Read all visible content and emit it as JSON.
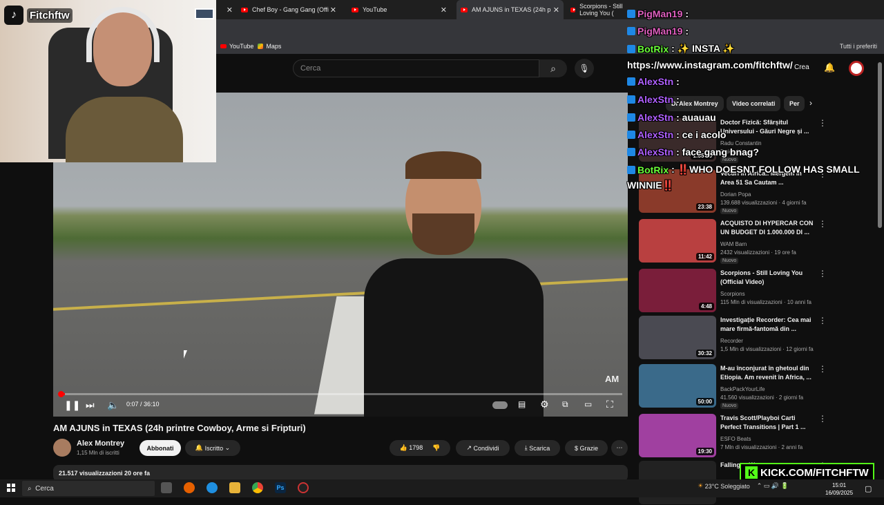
{
  "browser": {
    "tabs": [
      {
        "label": "Chef Boy - Gang Gang (Offi",
        "active": false
      },
      {
        "label": "YouTube",
        "active": false
      },
      {
        "label": "AM AJUNS in TEXAS (24h p",
        "active": true
      },
      {
        "label": "Scorpions - Still Loving You (",
        "active": false
      }
    ],
    "bookmarks": [
      "YouTube",
      "Maps"
    ],
    "all_bookmarks_label": "Tutti i preferiti"
  },
  "streamer": {
    "tiktok_name": "Fitchftw"
  },
  "header": {
    "search_placeholder": "Cerca",
    "create_label": "Crea"
  },
  "player": {
    "current_time": "0:07",
    "duration": "36:10",
    "time_display": "0:07 / 36:10",
    "progress_fraction": 0.0032,
    "watermark": "AM"
  },
  "video": {
    "title": "AM AJUNS in TEXAS (24h printre Cowboy, Arme si Fripturi)",
    "channel": "Alex Montrey",
    "subscribers": "1,15 Mln di iscritti",
    "subscribe_label": "Abbonati",
    "joined_label": "Iscritto",
    "likes": "1798",
    "share_label": "Condividi",
    "download_label": "Scarica",
    "thanks_label": "Grazie",
    "views_line": "21.517 visualizzazioni  20 ore fa"
  },
  "sidebar": {
    "chips": [
      "Di Alex Montrey",
      "Video correlati",
      "Per"
    ],
    "recs": [
      {
        "title": "Doctor Fizică: Sfârșitul Universului - Găuri Negre și ...",
        "channel": "Radu Constantin",
        "meta": "5 giorni fa",
        "badge": "Nuovo",
        "duration": "1:35:13",
        "thumb_color": "#3a2a2a"
      },
      {
        "title": "Vecuri în Africa.. Mergem în Area 51 Sa Cautam ...",
        "channel": "Dorian Popa",
        "meta": "139.688 visualizzazioni · 4 giorni fa",
        "badge": "Nuovo",
        "duration": "23:38",
        "thumb_color": "#8a3a2a"
      },
      {
        "title": "ACQUISTO DI HYPERCAR CON UN BUDGET DI 1.000.000 DI ...",
        "channel": "WAM Barn",
        "meta": "2432 visualizzazioni · 19 ore fa",
        "badge": "Nuovo",
        "duration": "11:42",
        "thumb_color": "#b94040"
      },
      {
        "title": "Scorpions - Still Loving You (Official Video)",
        "channel": "Scorpions",
        "meta": "115 Mln di visualizzazioni · 10 anni fa",
        "badge": "",
        "duration": "4:48",
        "thumb_color": "#7a1e3a"
      },
      {
        "title": "Investigație Recorder: Cea mai mare firmă-fantomă din ...",
        "channel": "Recorder",
        "meta": "1,5 Mln di visualizzazioni · 12 giorni fa",
        "badge": "",
        "duration": "30:32",
        "thumb_color": "#4a4a52"
      },
      {
        "title": "M-au înconjurat în ghetoul din Etiopia. Am revenit în Africa, ...",
        "channel": "BackPackYourLife",
        "meta": "41.560 visualizzazioni · 2 giorni fa",
        "badge": "Nuovo",
        "duration": "50:00",
        "thumb_color": "#3a6a8a"
      },
      {
        "title": "Travis Scott/Playboi Carti Perfect Transitions | Part 1 ...",
        "channel": "ESFO Beats",
        "meta": "7 Mln di visualizzazioni · 2 anni fa",
        "badge": "",
        "duration": "19:30",
        "thumb_color": "#a040a0"
      },
      {
        "title": "Falling ... Weap...",
        "channel": "",
        "meta": "",
        "badge": "",
        "duration": "",
        "thumb_color": "#222222"
      }
    ]
  },
  "chat": [
    {
      "user": "PigMan19",
      "msg": ":",
      "color": "#e060c0"
    },
    {
      "user": "PigMan19",
      "msg": ":",
      "color": "#e060c0"
    },
    {
      "user": "BotRix",
      "msg": ": ✨ INSTA ✨",
      "color": "#6bff3a"
    },
    {
      "user": "",
      "msg": "https://www.instagram.com/fitchftw/",
      "color": "#ffffff"
    },
    {
      "user": "AlexStn",
      "msg": ":",
      "color": "#b060ff"
    },
    {
      "user": "AlexStn",
      "msg": ":",
      "color": "#b060ff"
    },
    {
      "user": "AlexStn",
      "msg": ": auauau",
      "color": "#b060ff"
    },
    {
      "user": "AlexStn",
      "msg": ": ce i acolo",
      "color": "#b060ff"
    },
    {
      "user": "AlexStn",
      "msg": ": face gang bnag?",
      "color": "#b060ff"
    },
    {
      "user": "BotRix",
      "msg": ": ‼️WHO DOESNT FOLLOW HAS SMALL",
      "color": "#6bff3a"
    },
    {
      "user": "",
      "msg": "WINNIE‼️",
      "color": "#ffffff"
    }
  ],
  "kick": {
    "label": "KICK.COM/FITCHFTW"
  },
  "taskbar": {
    "search_placeholder": "Cerca",
    "weather": "23°C  Soleggiato",
    "time": "15:01",
    "date": "16/09/2025"
  }
}
